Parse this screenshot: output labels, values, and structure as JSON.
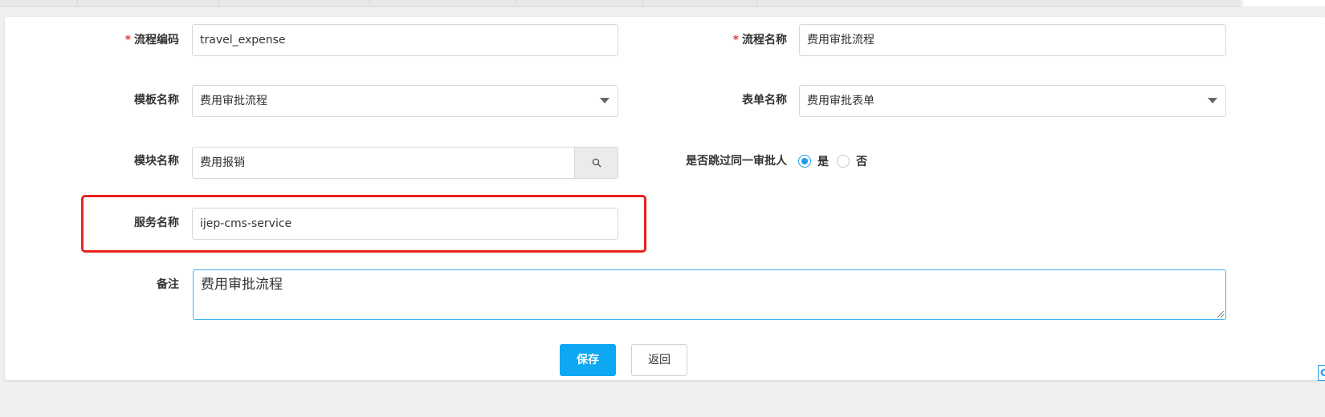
{
  "form": {
    "process_code": {
      "label": "流程编码",
      "value": "travel_expense",
      "required": true
    },
    "process_name": {
      "label": "流程名称",
      "value": "费用审批流程",
      "required": true
    },
    "template_name": {
      "label": "模板名称",
      "value": "费用审批流程"
    },
    "form_name": {
      "label": "表单名称",
      "value": "费用审批表单"
    },
    "module_name": {
      "label": "模块名称",
      "value": "费用报销"
    },
    "skip_same_approver": {
      "label": "是否跳过同一审批人",
      "options": [
        "是",
        "否"
      ],
      "selected": "是"
    },
    "service_name": {
      "label": "服务名称",
      "value": "ijep-cms-service"
    },
    "remarks": {
      "label": "备注",
      "value": "费用审批流程"
    },
    "required_mark": "*"
  },
  "actions": {
    "save_label": "保存",
    "back_label": "返回"
  },
  "colors": {
    "primary": "#0ea8f2",
    "required": "#e4393c",
    "highlight": "#e8231c",
    "radio_checked": "#1a9cf0"
  },
  "icons": {
    "module_search": "search-icon",
    "select_arrow": "chevron-down-icon"
  },
  "edge_widget_text": "C"
}
